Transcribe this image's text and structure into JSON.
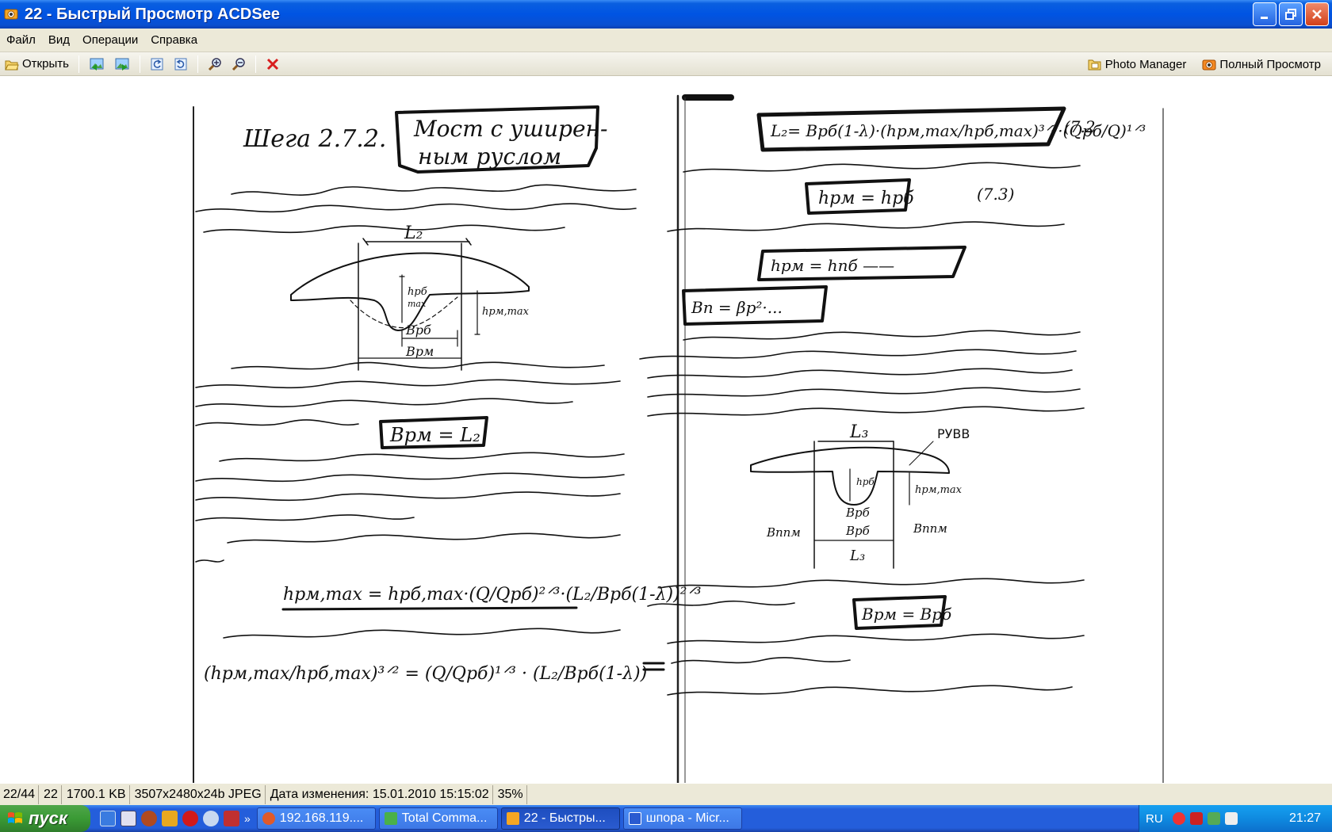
{
  "window": {
    "title": "22 - Быстрый Просмотр ACDSee"
  },
  "menu": [
    "Файл",
    "Вид",
    "Операции",
    "Справка"
  ],
  "toolbar": {
    "open_label": "Открыть",
    "photo_manager_label": "Photo Manager",
    "full_view_label": "Полный Просмотр"
  },
  "document": {
    "left_heading": "Шeгa 2.7.2. Мост с уширен- ным руслом",
    "right_label_ruvv": "РУВВ"
  },
  "statusbar": {
    "position": "22/44",
    "index": "22",
    "filesize": "1700.1 KB",
    "format": "3507x2480x24b JPEG",
    "modified": "Дата изменения: 15.01.2010 15:15:02",
    "zoom": "35%"
  },
  "taskbar": {
    "start_label": "пуск",
    "tasks": [
      {
        "label": "192.168.119....",
        "active": false
      },
      {
        "label": "Total Comma...",
        "active": false
      },
      {
        "label": "22 - Быстры...",
        "active": true
      },
      {
        "label": "шпора - Micr...",
        "active": false
      }
    ],
    "lang": "RU",
    "clock": "21:27"
  },
  "colors": {
    "title_bar": "#0054e3",
    "chrome": "#ece9d8",
    "taskbar": "#245edb",
    "start": "#3a9a35",
    "tray": "#0f8ae0"
  }
}
